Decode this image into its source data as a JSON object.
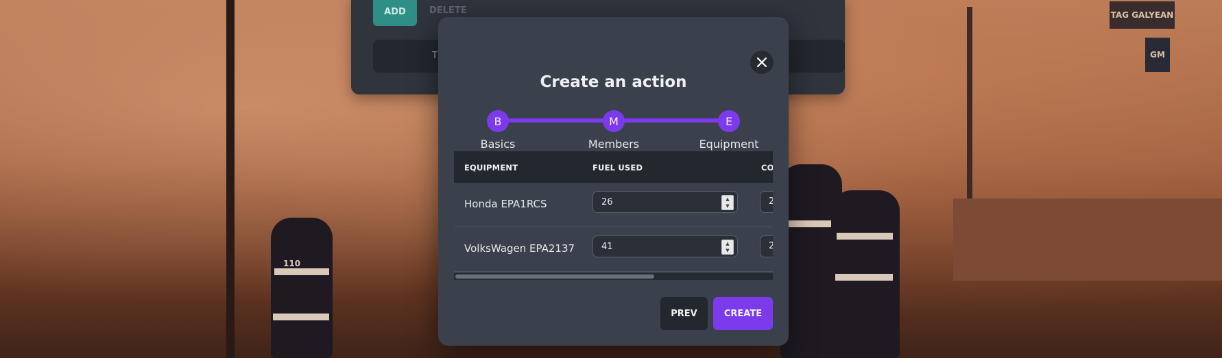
{
  "background_panel": {
    "add_label": "ADD",
    "delete_label": "DELETE",
    "bar_text": "T"
  },
  "modal": {
    "title": "Create an action",
    "close_icon": "close-icon",
    "steps": [
      {
        "letter": "B",
        "label": "Basics"
      },
      {
        "letter": "M",
        "label": "Members"
      },
      {
        "letter": "E",
        "label": "Equipment"
      }
    ],
    "accent_color": "#7c3aed",
    "table": {
      "columns": [
        "EQUIPMENT",
        "FUEL USED",
        "CO"
      ],
      "rows": [
        {
          "equipment": "Honda EPA1RCS",
          "fuel_used": "26",
          "third": "2"
        },
        {
          "equipment": "VolksWagen EPA2137",
          "fuel_used": "41",
          "third": "2"
        }
      ]
    },
    "prev_label": "PREV",
    "create_label": "CREATE"
  },
  "scene": {
    "sign_top": "TAG GALYEAN",
    "sign_gm": "GM",
    "helmet_number": "110"
  }
}
